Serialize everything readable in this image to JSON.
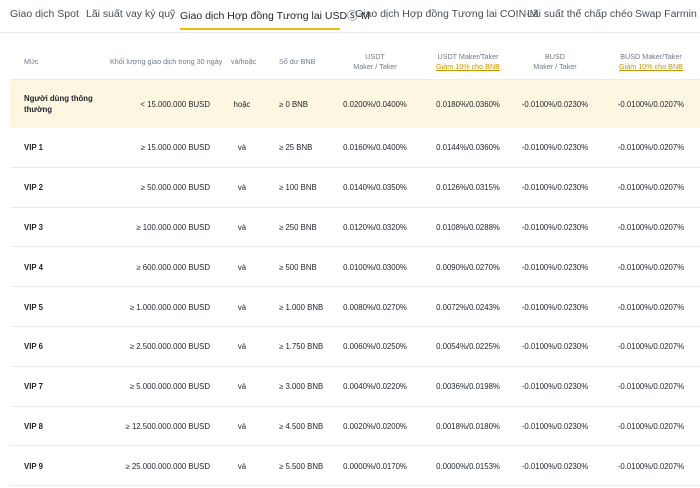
{
  "tabs": [
    {
      "label": "Giao dịch Spot",
      "active": false
    },
    {
      "label": "Lãi suất vay ký quỹ",
      "active": false
    },
    {
      "label": "Giao dịch Hợp đồng Tương lai USDⓈ-M",
      "active": true
    },
    {
      "label": "Giao dịch Hợp đồng Tương lai COIN-M",
      "active": false
    },
    {
      "label": "Lãi suất thế chấp chéo",
      "active": false
    },
    {
      "label": "Swap Farmin",
      "active": false
    }
  ],
  "accent_color": "#f0b90b",
  "highlight_color": "#fdf6e1",
  "table": {
    "headers": {
      "level": "Mức",
      "volume": "Khối lượng giao dịch trong 30 ngày",
      "andor": "và/hoặc",
      "bnb": "Số dư BNB",
      "usdt_line1": "USDT",
      "usdt_line2": "Maker / Taker",
      "usdt_disc_line1": "USDT Maker/Taker",
      "usdt_disc_line2": "Giảm 10% cho BNB",
      "busd_line1": "BUSD",
      "busd_line2": "Maker / Taker",
      "busd_disc_line1": "BUSD Maker/Taker",
      "busd_disc_line2": "Giảm 10% cho BNB"
    },
    "rows": [
      {
        "tier": "Người dùng thông thường",
        "volume": "< 15.000.000 BUSD",
        "andor": "hoặc",
        "bnb": "≥ 0 BNB",
        "usdt": "0.0200%/0.0400%",
        "usdt_disc": "0.0180%/0.0360%",
        "busd": "-0.0100%/0.0230%",
        "busd_disc": "-0.0100%/0.0207%"
      },
      {
        "tier": "VIP 1",
        "volume": "≥ 15.000.000 BUSD",
        "andor": "và",
        "bnb": "≥ 25 BNB",
        "usdt": "0.0160%/0.0400%",
        "usdt_disc": "0.0144%/0.0360%",
        "busd": "-0.0100%/0.0230%",
        "busd_disc": "-0.0100%/0.0207%"
      },
      {
        "tier": "VIP 2",
        "volume": "≥ 50.000.000 BUSD",
        "andor": "và",
        "bnb": "≥ 100 BNB",
        "usdt": "0.0140%/0.0350%",
        "usdt_disc": "0.0126%/0.0315%",
        "busd": "-0.0100%/0.0230%",
        "busd_disc": "-0.0100%/0.0207%"
      },
      {
        "tier": "VIP 3",
        "volume": "≥ 100.000.000 BUSD",
        "andor": "và",
        "bnb": "≥ 250 BNB",
        "usdt": "0.0120%/0.0320%",
        "usdt_disc": "0.0108%/0.0288%",
        "busd": "-0.0100%/0.0230%",
        "busd_disc": "-0.0100%/0.0207%"
      },
      {
        "tier": "VIP 4",
        "volume": "≥ 600.000.000 BUSD",
        "andor": "và",
        "bnb": "≥ 500 BNB",
        "usdt": "0.0100%/0.0300%",
        "usdt_disc": "0.0090%/0.0270%",
        "busd": "-0.0100%/0.0230%",
        "busd_disc": "-0.0100%/0.0207%"
      },
      {
        "tier": "VIP 5",
        "volume": "≥ 1.000.000.000 BUSD",
        "andor": "và",
        "bnb": "≥ 1.000 BNB",
        "usdt": "0.0080%/0.0270%",
        "usdt_disc": "0.0072%/0.0243%",
        "busd": "-0.0100%/0.0230%",
        "busd_disc": "-0.0100%/0.0207%"
      },
      {
        "tier": "VIP 6",
        "volume": "≥ 2.500.000.000 BUSD",
        "andor": "và",
        "bnb": "≥ 1.750 BNB",
        "usdt": "0.0060%/0.0250%",
        "usdt_disc": "0.0054%/0.0225%",
        "busd": "-0.0100%/0.0230%",
        "busd_disc": "-0.0100%/0.0207%"
      },
      {
        "tier": "VIP 7",
        "volume": "≥ 5.000.000.000 BUSD",
        "andor": "và",
        "bnb": "≥ 3.000 BNB",
        "usdt": "0.0040%/0.0220%",
        "usdt_disc": "0.0036%/0.0198%",
        "busd": "-0.0100%/0.0230%",
        "busd_disc": "-0.0100%/0.0207%"
      },
      {
        "tier": "VIP 8",
        "volume": "≥ 12.500.000.000 BUSD",
        "andor": "và",
        "bnb": "≥ 4.500 BNB",
        "usdt": "0.0020%/0.0200%",
        "usdt_disc": "0.0018%/0.0180%",
        "busd": "-0.0100%/0.0230%",
        "busd_disc": "-0.0100%/0.0207%"
      },
      {
        "tier": "VIP 9",
        "volume": "≥ 25.000.000.000 BUSD",
        "andor": "và",
        "bnb": "≥ 5.500 BNB",
        "usdt": "0.0000%/0.0170%",
        "usdt_disc": "0.0000%/0.0153%",
        "busd": "-0.0100%/0.0230%",
        "busd_disc": "-0.0100%/0.0207%"
      }
    ]
  }
}
